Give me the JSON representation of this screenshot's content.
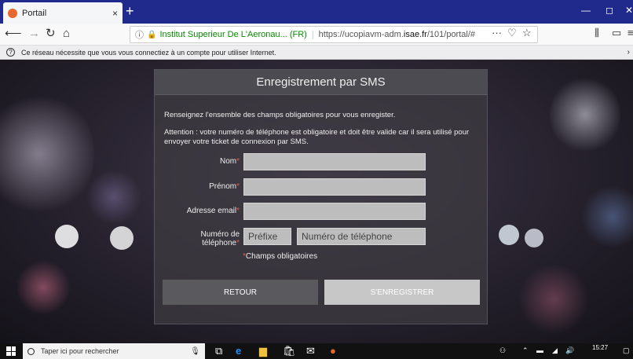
{
  "browser": {
    "tab_title": "Portail",
    "tab_close": "×",
    "new_tab": "+",
    "url_site": "Institut Superieur De L'Aeronau... (FR)",
    "url_prefix": "https://ucopiavm-adm.",
    "url_domain": "isae.fr",
    "url_path": "/101/portal/#",
    "notification": "Ce réseau nécessite que vous vous connectiez à un compte pour utiliser Internet."
  },
  "dialog": {
    "title": "Enregistrement par SMS",
    "intro": "Renseignez l'ensemble des champs obligatoires pour vous enregister.",
    "warning": "Attention : votre numéro de téléphone est obligatoire et doit être valide car il sera utilisé pour envoyer votre ticket de connexion par SMS.",
    "fields": {
      "nom_label": "Nom",
      "prenom_label": "Prénom",
      "email_label": "Adresse email",
      "phone_label_line1": "Numéro de",
      "phone_label_line2": "téléphone",
      "prefix_placeholder": "Préfixe",
      "phone_placeholder": "Numéro de téléphone",
      "required_mark": "*"
    },
    "required_note": "Champs obligatoires",
    "back_button": "RETOUR",
    "register_button": "S'ENREGISTRER"
  },
  "taskbar": {
    "search_placeholder": "Taper ici pour rechercher",
    "time": "15:27"
  },
  "colors": {
    "tabbar": "#1f2a8c",
    "required": "#e9573f",
    "register_button": "#c7c7c7",
    "back_button": "#5a595d"
  }
}
